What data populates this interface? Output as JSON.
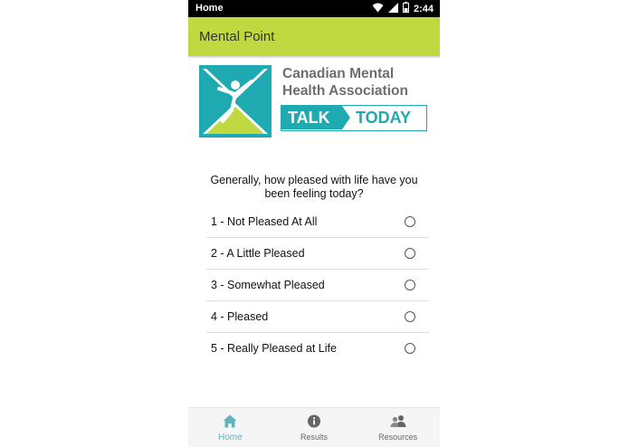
{
  "status_bar": {
    "left_label": "Home",
    "time": "2:44",
    "icons": [
      "wifi-icon",
      "signal-icon",
      "battery-icon"
    ]
  },
  "app_bar": {
    "title": "Mental Point",
    "color": "#c0d940"
  },
  "logo": {
    "org_name": "Canadian Mental Health Association",
    "talk": "TALK",
    "today": "TODAY",
    "accent": "#1fa9b1"
  },
  "survey": {
    "question": "Generally, how pleased with life have you been feeling today?",
    "options": [
      {
        "label": "1 - Not Pleased At All"
      },
      {
        "label": "2 - A Little Pleased"
      },
      {
        "label": "3 - Somewhat Pleased"
      },
      {
        "label": "4 - Pleased"
      },
      {
        "label": "5 - Really Pleased at Life"
      }
    ]
  },
  "bottom_nav": {
    "items": [
      {
        "label": "Home",
        "icon": "home-icon",
        "active": true
      },
      {
        "label": "Results",
        "icon": "info-icon",
        "active": false
      },
      {
        "label": "Resources",
        "icon": "people-icon",
        "active": false
      }
    ],
    "active_color": "#5fb3bb"
  }
}
